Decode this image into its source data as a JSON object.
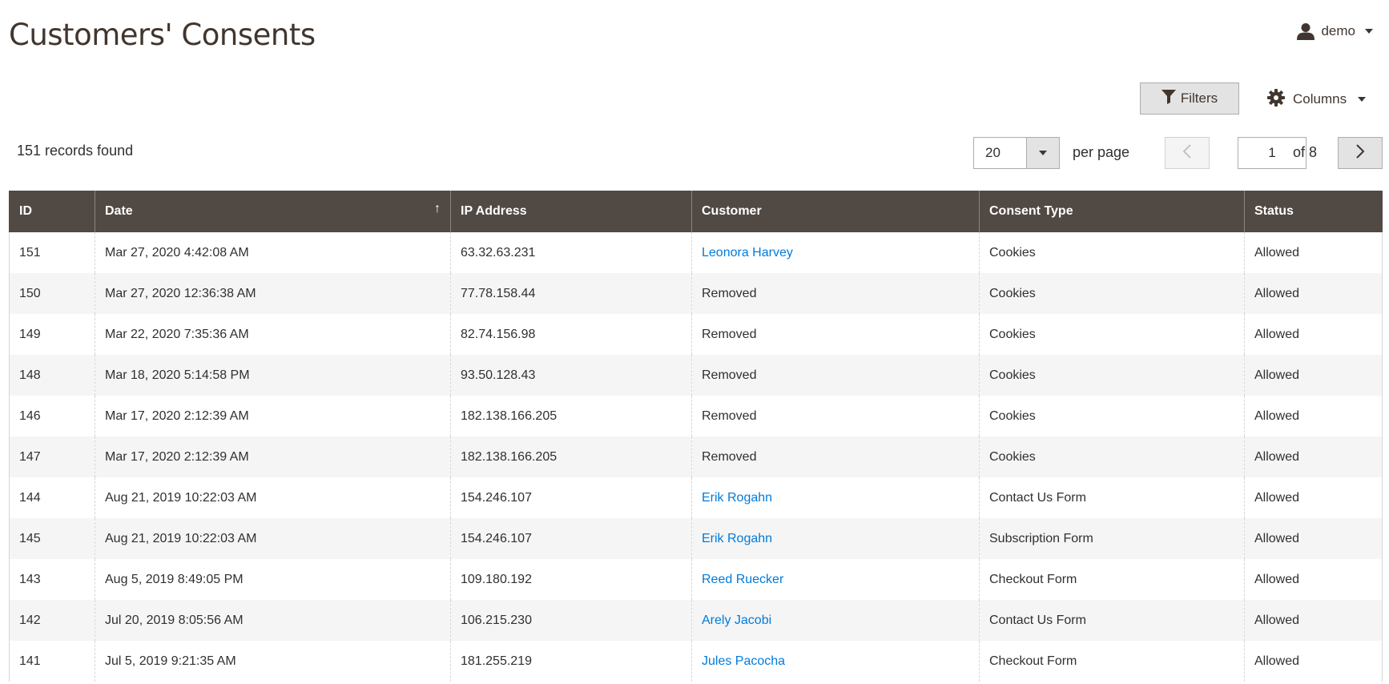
{
  "header": {
    "title": "Customers' Consents",
    "user": "demo"
  },
  "toolbar": {
    "filters_label": "Filters",
    "columns_label": "Columns"
  },
  "pager": {
    "records_found": "151 records found",
    "per_page_value": "20",
    "per_page_label": "per page",
    "current_page": "1",
    "total_pages_label": "of 8"
  },
  "colors": {
    "header_bg": "#514943",
    "link": "#007bdb"
  },
  "table": {
    "columns": [
      "ID",
      "Date",
      "IP Address",
      "Customer",
      "Consent Type",
      "Status"
    ],
    "sorted_column": "Date",
    "sort_direction": "ascending",
    "rows": [
      {
        "id": "151",
        "date": "Mar 27, 2020 4:42:08 AM",
        "ip": "63.32.63.231",
        "customer": "Leonora Harvey",
        "customer_link": true,
        "type": "Cookies",
        "status": "Allowed"
      },
      {
        "id": "150",
        "date": "Mar 27, 2020 12:36:38 AM",
        "ip": "77.78.158.44",
        "customer": "Removed",
        "customer_link": false,
        "type": "Cookies",
        "status": "Allowed"
      },
      {
        "id": "149",
        "date": "Mar 22, 2020 7:35:36 AM",
        "ip": "82.74.156.98",
        "customer": "Removed",
        "customer_link": false,
        "type": "Cookies",
        "status": "Allowed"
      },
      {
        "id": "148",
        "date": "Mar 18, 2020 5:14:58 PM",
        "ip": "93.50.128.43",
        "customer": "Removed",
        "customer_link": false,
        "type": "Cookies",
        "status": "Allowed"
      },
      {
        "id": "146",
        "date": "Mar 17, 2020 2:12:39 AM",
        "ip": "182.138.166.205",
        "customer": "Removed",
        "customer_link": false,
        "type": "Cookies",
        "status": "Allowed"
      },
      {
        "id": "147",
        "date": "Mar 17, 2020 2:12:39 AM",
        "ip": "182.138.166.205",
        "customer": "Removed",
        "customer_link": false,
        "type": "Cookies",
        "status": "Allowed"
      },
      {
        "id": "144",
        "date": "Aug 21, 2019 10:22:03 AM",
        "ip": "154.246.107",
        "customer": "Erik Rogahn",
        "customer_link": true,
        "type": "Contact Us Form",
        "status": "Allowed"
      },
      {
        "id": "145",
        "date": "Aug 21, 2019 10:22:03 AM",
        "ip": "154.246.107",
        "customer": "Erik Rogahn",
        "customer_link": true,
        "type": "Subscription Form",
        "status": "Allowed"
      },
      {
        "id": "143",
        "date": "Aug 5, 2019 8:49:05 PM",
        "ip": "109.180.192",
        "customer": "Reed Ruecker",
        "customer_link": true,
        "type": "Checkout Form",
        "status": "Allowed"
      },
      {
        "id": "142",
        "date": "Jul 20, 2019 8:05:56 AM",
        "ip": "106.215.230",
        "customer": "Arely Jacobi",
        "customer_link": true,
        "type": "Contact Us Form",
        "status": "Allowed"
      },
      {
        "id": "141",
        "date": "Jul 5, 2019 9:21:35 AM",
        "ip": "181.255.219",
        "customer": "Jules Pacocha",
        "customer_link": true,
        "type": "Checkout Form",
        "status": "Allowed"
      }
    ]
  }
}
